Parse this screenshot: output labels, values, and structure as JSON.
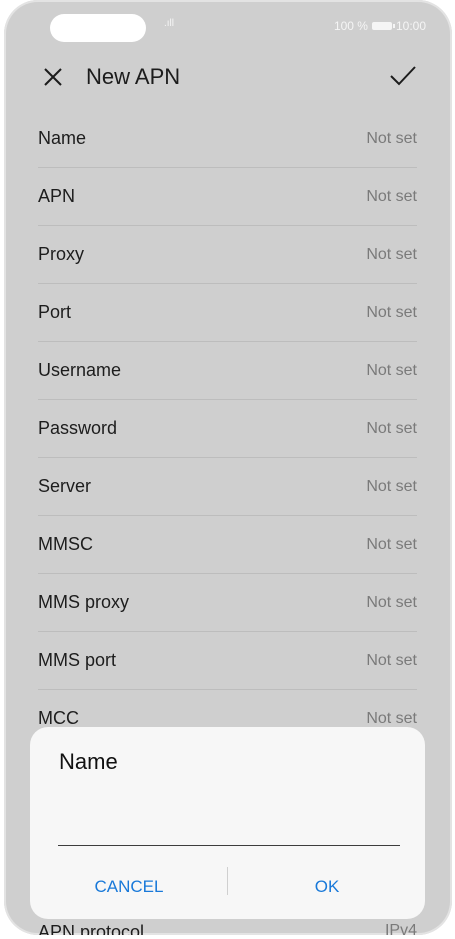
{
  "status_bar": {
    "signal": ".ıll",
    "battery": "100 %",
    "time": "10:00"
  },
  "header": {
    "title": "New APN"
  },
  "fields": [
    {
      "label": "Name",
      "value": "Not set"
    },
    {
      "label": "APN",
      "value": "Not set"
    },
    {
      "label": "Proxy",
      "value": "Not set"
    },
    {
      "label": "Port",
      "value": "Not set"
    },
    {
      "label": "Username",
      "value": "Not set"
    },
    {
      "label": "Password",
      "value": "Not set"
    },
    {
      "label": "Server",
      "value": "Not set"
    },
    {
      "label": "MMSC",
      "value": "Not set"
    },
    {
      "label": "MMS proxy",
      "value": "Not set"
    },
    {
      "label": "MMS port",
      "value": "Not set"
    },
    {
      "label": "MCC",
      "value": "Not set"
    }
  ],
  "peek_row": {
    "label": "APN protocol",
    "value": "IPv4"
  },
  "dialog": {
    "title": "Name",
    "input_value": "",
    "cancel_label": "CANCEL",
    "ok_label": "OK"
  },
  "colors": {
    "accent": "#1979d9",
    "overlay": "#cfcfcf",
    "dialog_bg": "#f7f7f7"
  }
}
